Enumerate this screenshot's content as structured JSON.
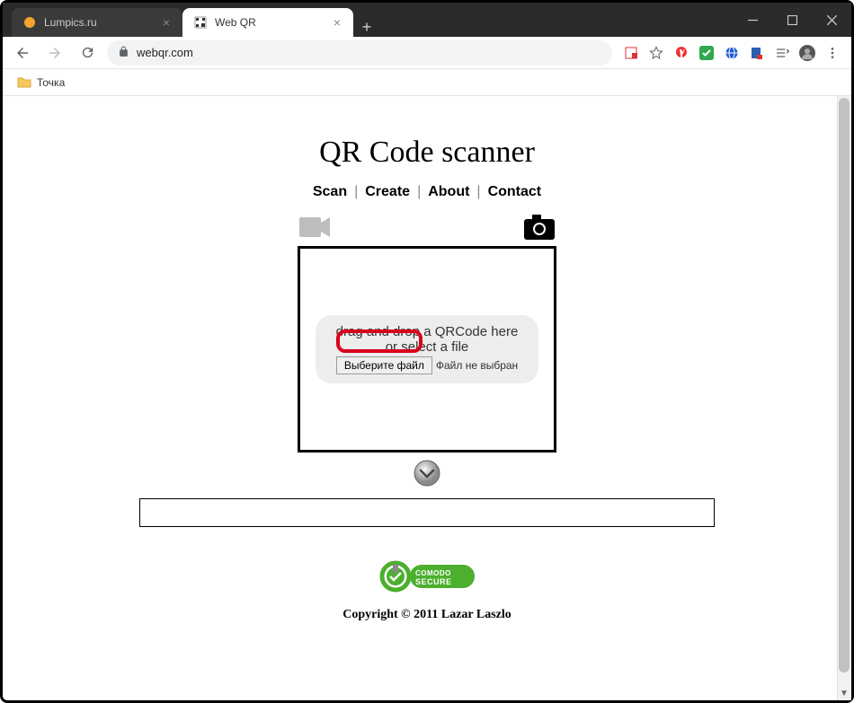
{
  "window": {
    "tabs": [
      {
        "title": "Lumpics.ru",
        "active": false
      },
      {
        "title": "Web QR",
        "active": true
      }
    ],
    "url": "webqr.com"
  },
  "bookmarks": {
    "item1": "Точка"
  },
  "page": {
    "title": "QR Code scanner",
    "nav": {
      "scan": "Scan",
      "create": "Create",
      "about": "About",
      "contact": "Contact"
    },
    "drop": {
      "line1": "drag and drop a QRCode here",
      "line2": "or select a file",
      "button": "Выберите файл",
      "status": "Файл не выбран"
    },
    "copyright": "Copyright © 2011 Lazar Laszlo"
  },
  "seal": {
    "line1": "COMODO",
    "line2": "SECURE"
  }
}
